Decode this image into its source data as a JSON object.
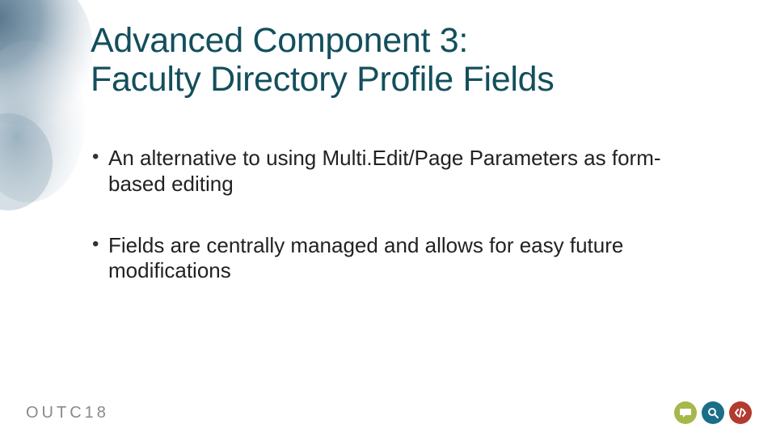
{
  "title": {
    "line1": "Advanced Component 3:",
    "line2": "Faculty Directory Profile Fields"
  },
  "bullets": [
    "An alternative to using Multi.Edit/Page Parameters as form-based editing",
    "Fields are centrally managed and allows for easy future modifications"
  ],
  "footer": {
    "logo_text": "OUTC18"
  },
  "icons": {
    "decor": "watercolor-blot",
    "footer": [
      "speech-bubble-icon",
      "search-icon",
      "code-icon"
    ]
  },
  "colors": {
    "title": "#134f5c",
    "icon_green": "#a6b84a",
    "icon_blue": "#1a6e87",
    "icon_red": "#b23a2f"
  }
}
